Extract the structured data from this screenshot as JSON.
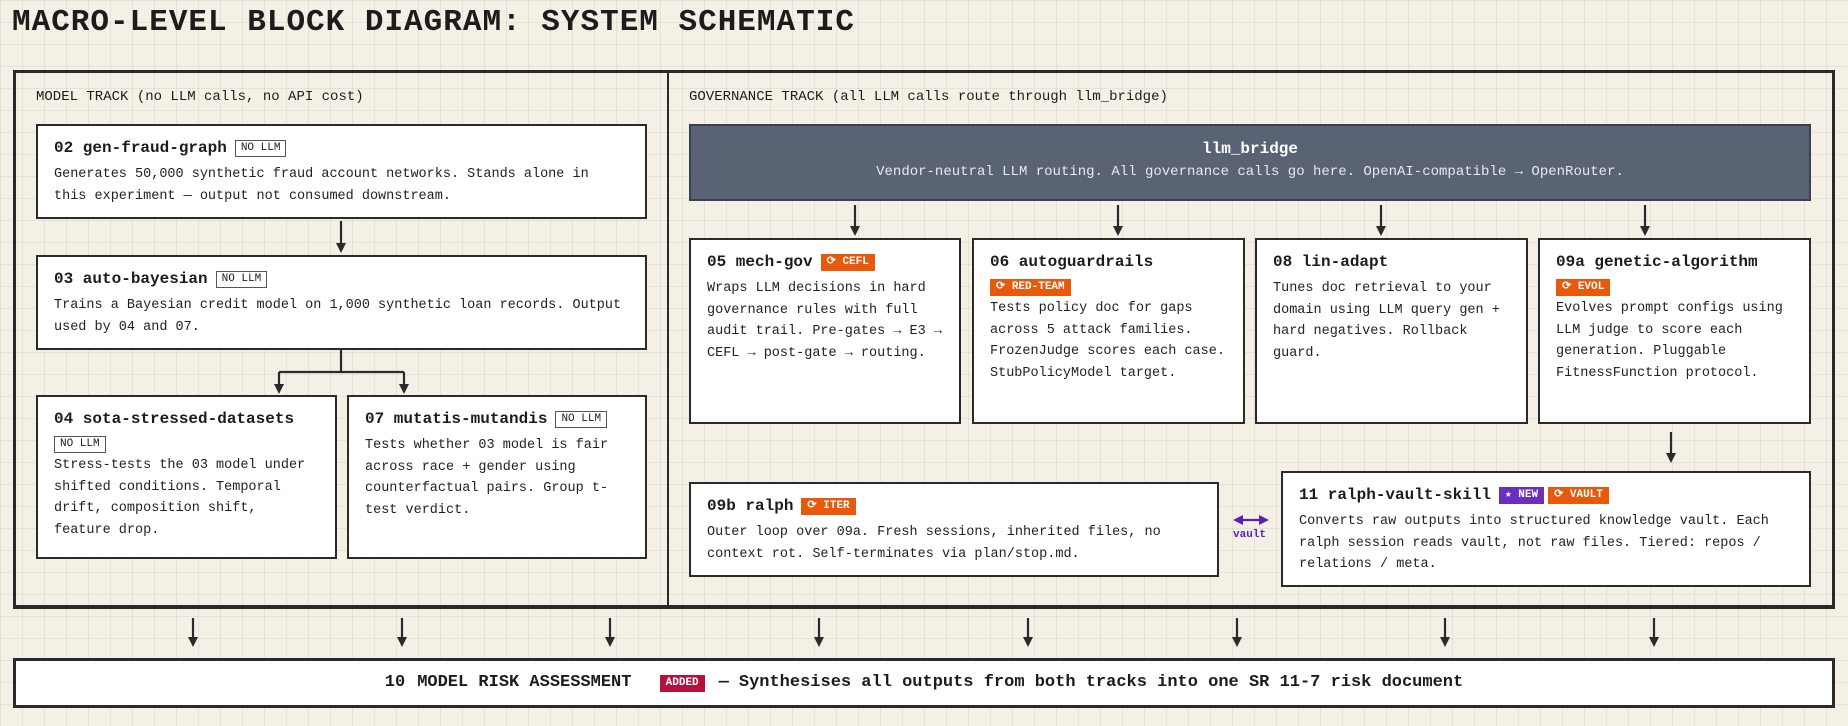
{
  "title": "MACRO-LEVEL BLOCK DIAGRAM: SYSTEM SCHEMATIC",
  "model_track": {
    "label": "MODEL TRACK (no LLM calls, no API cost)",
    "boxes": [
      {
        "title": "02 gen-fraud-graph",
        "tag": "NO LLM",
        "desc": "Generates 50,000 synthetic fraud account networks. Stands alone in this experiment — output not consumed downstream."
      },
      {
        "title": "03 auto-bayesian",
        "tag": "NO LLM",
        "desc": "Trains a Bayesian credit model on 1,000 synthetic loan records. Output used by 04 and 07."
      },
      {
        "title": "04 sota-stressed-datasets",
        "tag": "NO LLM",
        "desc": "Stress-tests the 03 model under shifted conditions. Temporal drift, composition shift, feature drop."
      },
      {
        "title": "07 mutatis-mutandis",
        "tag": "NO LLM",
        "desc": "Tests whether 03 model is fair across race + gender using counterfactual pairs. Group t-test verdict."
      }
    ]
  },
  "governance_track": {
    "label": "GOVERNANCE TRACK (all LLM calls route through llm_bridge)",
    "bridge": {
      "title": "llm_bridge",
      "desc": "Vendor-neutral LLM routing. All governance calls go here. OpenAI-compatible → OpenRouter."
    },
    "boxes": [
      {
        "title": "05 mech-gov",
        "tag": "⟳ CEFL",
        "desc": "Wraps LLM decisions in hard governance rules with full audit trail. Pre-gates → E3 → CEFL → post-gate → routing."
      },
      {
        "title": "06 autoguardrails",
        "tag": "⟳ RED-TEAM",
        "desc": "Tests policy doc for gaps across 5 attack families. FrozenJudge scores each case. StubPolicyModel target."
      },
      {
        "title": "08 lin-adapt",
        "tag": "",
        "desc": "Tunes doc retrieval to your domain using LLM query gen + hard negatives. Rollback guard."
      },
      {
        "title": "09a genetic-algorithm",
        "tag": "⟳ EVOL",
        "desc": "Evolves prompt configs using LLM judge to score each generation. Pluggable FitnessFunction protocol."
      }
    ],
    "ralph": {
      "title": "09b ralph",
      "tag": "⟳ ITER",
      "desc": "Outer loop over 09a. Fresh sessions, inherited files, no context rot. Self-terminates via plan/stop.md."
    },
    "vault": {
      "title": "11 ralph-vault-skill",
      "tag_new": "★ NEW",
      "tag_vault": "⟳ VAULT",
      "desc": "Converts raw outputs into structured knowledge vault. Each ralph session reads vault, not raw files. Tiered: repos / relations / meta."
    },
    "vault_arrow_label": "vault"
  },
  "bottom": {
    "number": "10",
    "title": "MODEL RISK ASSESSMENT",
    "tag": "ADDED",
    "dash": "—",
    "desc": "Synthesises all outputs from both tracks into one SR 11-7 risk document"
  },
  "colors": {
    "tag_orange": "#e8590c",
    "tag_purple": "#6a2fc1",
    "tag_crimson": "#b3123c",
    "bridge_bg": "#5a6374",
    "vault_arrow": "#5b21b6",
    "line": "#2a2a2a"
  }
}
